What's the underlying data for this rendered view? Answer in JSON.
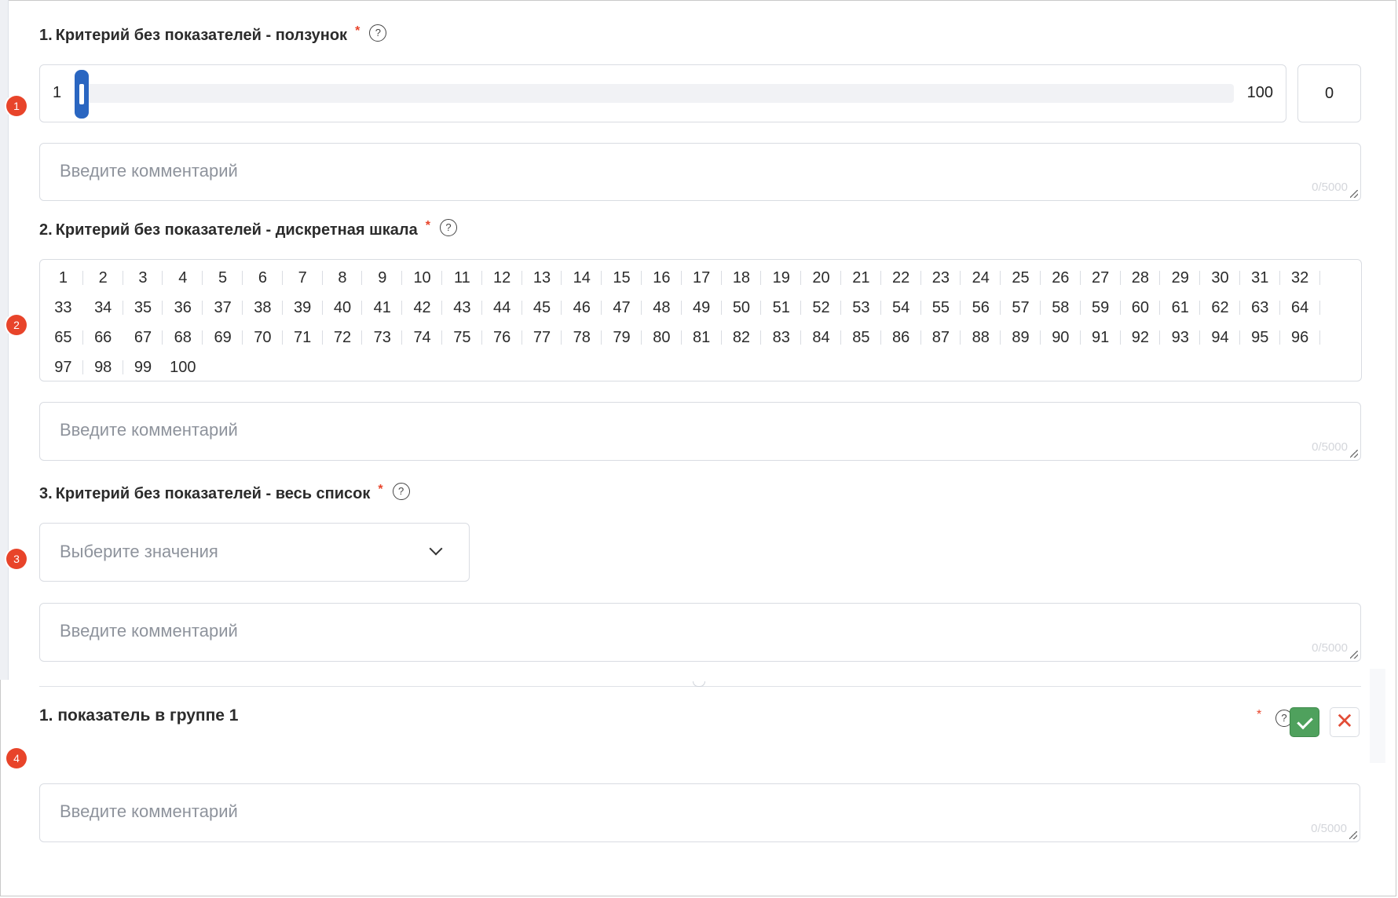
{
  "questions": [
    {
      "number_label": "1.",
      "title": "Критерий без показателей - ползунок",
      "marker": "1",
      "slider": {
        "min_label": "1",
        "max_label": "100",
        "min": 1,
        "max": 100,
        "position_fraction": 0.0
      },
      "value": "0",
      "comment": {
        "placeholder": "Введите комментарий",
        "counter": "0/5000"
      }
    },
    {
      "number_label": "2.",
      "title": "Критерий без показателей - дискретная шкала",
      "marker": "2",
      "scale": {
        "values": [
          "1",
          "2",
          "3",
          "4",
          "5",
          "6",
          "7",
          "8",
          "9",
          "10",
          "11",
          "12",
          "13",
          "14",
          "15",
          "16",
          "17",
          "18",
          "19",
          "20",
          "21",
          "22",
          "23",
          "24",
          "25",
          "26",
          "27",
          "28",
          "29",
          "30",
          "31",
          "32",
          "33",
          "34",
          "35",
          "36",
          "37",
          "38",
          "39",
          "40",
          "41",
          "42",
          "43",
          "44",
          "45",
          "46",
          "47",
          "48",
          "49",
          "50",
          "51",
          "52",
          "53",
          "54",
          "55",
          "56",
          "57",
          "58",
          "59",
          "60",
          "61",
          "62",
          "63",
          "64",
          "65",
          "66",
          "67",
          "68",
          "69",
          "70",
          "71",
          "72",
          "73",
          "74",
          "75",
          "76",
          "77",
          "78",
          "79",
          "80",
          "81",
          "82",
          "83",
          "84",
          "85",
          "86",
          "87",
          "88",
          "89",
          "90",
          "91",
          "92",
          "93",
          "94",
          "95",
          "96",
          "97",
          "98",
          "99",
          "100"
        ]
      },
      "comment": {
        "placeholder": "Введите комментарий",
        "counter": "0/5000"
      }
    },
    {
      "number_label": "3.",
      "title": "Критерий без показателей - весь список",
      "marker": "3",
      "select": {
        "placeholder": "Выберите значения"
      },
      "comment": {
        "placeholder": "Введите комментарий",
        "counter": "0/5000"
      }
    }
  ],
  "indicator": {
    "number_label": "1.",
    "title": "показатель в группе 1",
    "marker": "4",
    "confirm_icon": "check-icon",
    "cancel_icon": "close-icon",
    "comment": {
      "placeholder": "Введите комментарий",
      "counter": "0/5000"
    }
  },
  "required_mark": "*",
  "help_glyph": "?",
  "colors": {
    "accent": "#2a66c1",
    "required": "#e8442a",
    "confirm": "#4fa15d",
    "cancel": "#e24c36"
  }
}
